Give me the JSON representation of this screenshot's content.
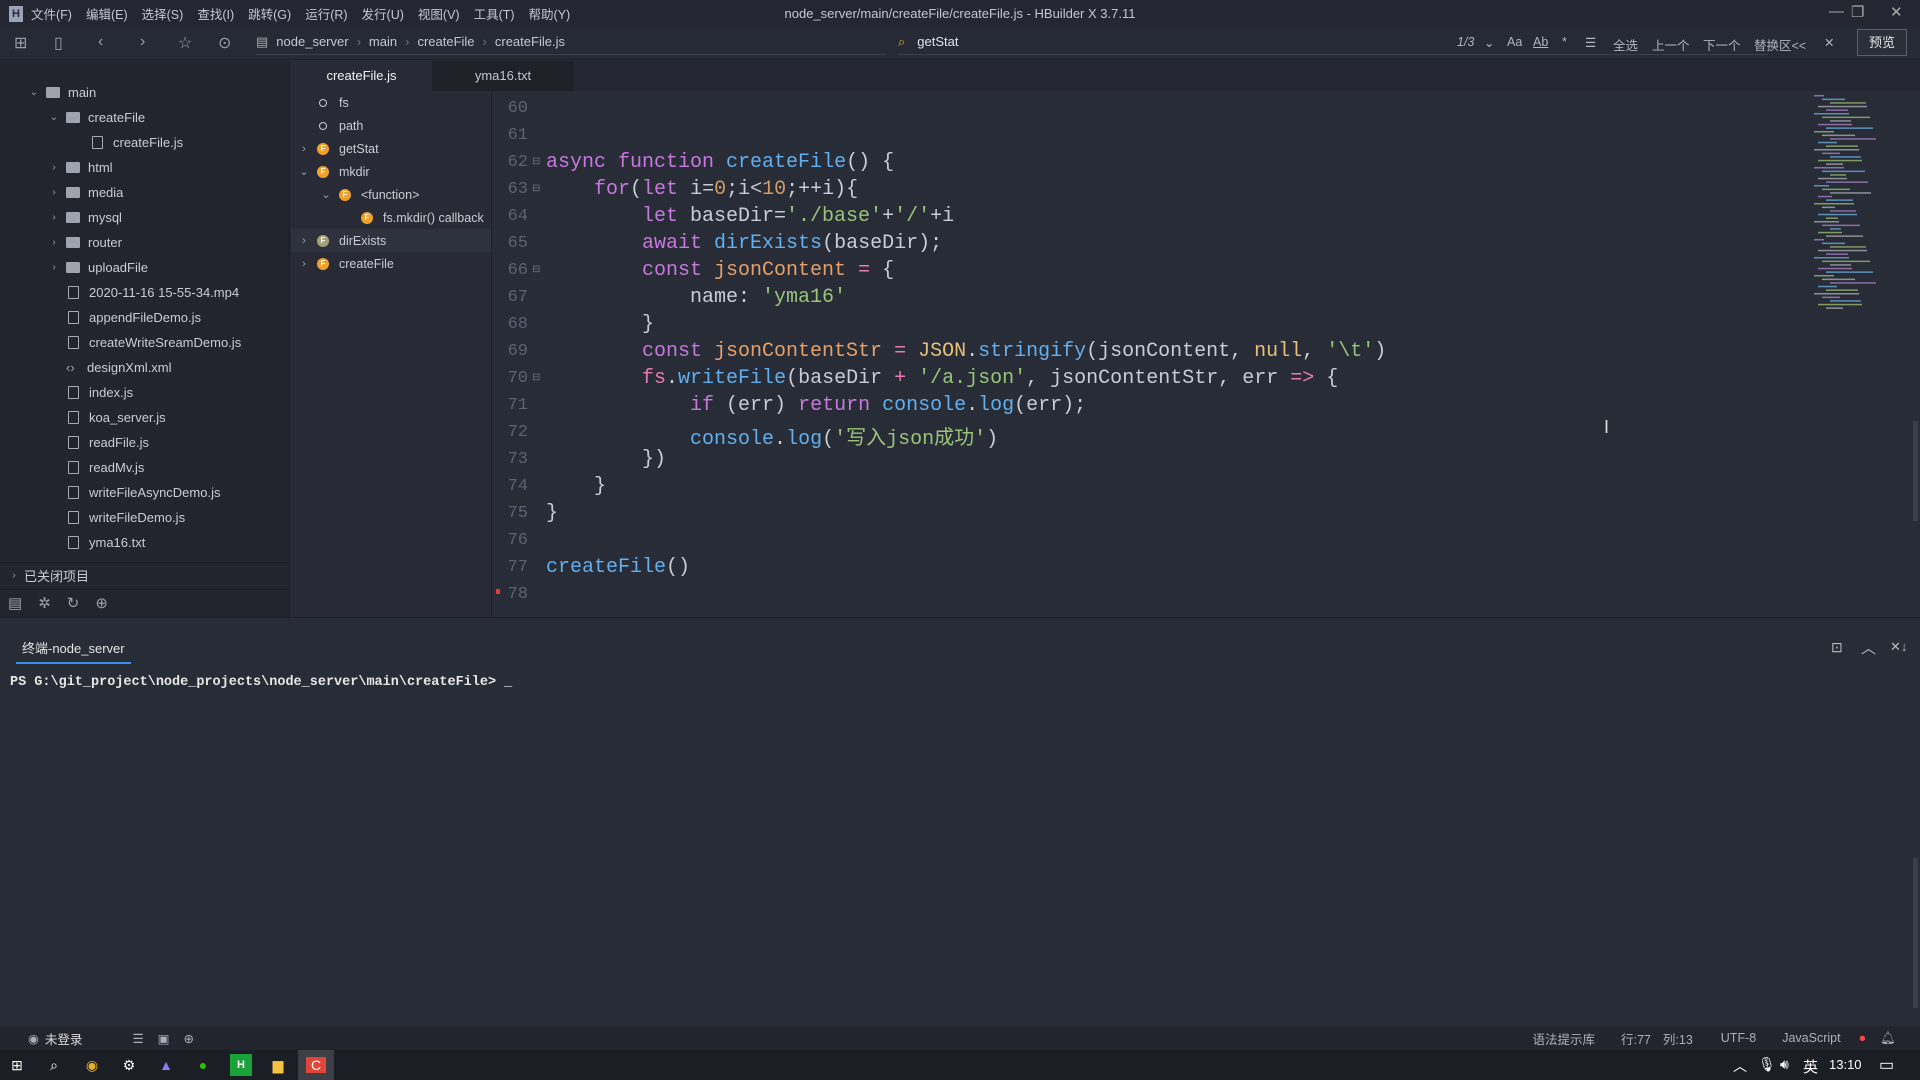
{
  "window": {
    "title": "node_server/main/createFile/createFile.js - HBuilder X 3.7.11",
    "logo": "H"
  },
  "menu": [
    "文件(F)",
    "编辑(E)",
    "选择(S)",
    "查找(I)",
    "跳转(G)",
    "运行(R)",
    "发行(U)",
    "视图(V)",
    "工具(T)",
    "帮助(Y)"
  ],
  "breadcrumb": [
    "node_server",
    "main",
    "createFile",
    "createFile.js"
  ],
  "search": {
    "value": "getStat",
    "count": "1/3",
    "options": [
      "Aa",
      "Ab",
      "*",
      "全选",
      "上一个",
      "下一个",
      "替换区<<"
    ],
    "preview": "预览"
  },
  "sidebar": {
    "tree": [
      {
        "label": "main",
        "type": "folder",
        "open": true,
        "depth": 0
      },
      {
        "label": "createFile",
        "type": "folder",
        "open": true,
        "depth": 1
      },
      {
        "label": "createFile.js",
        "type": "file",
        "depth": 2
      },
      {
        "label": "html",
        "type": "folder",
        "depth": 1
      },
      {
        "label": "media",
        "type": "folder",
        "depth": 1
      },
      {
        "label": "mysql",
        "type": "folder",
        "depth": 1
      },
      {
        "label": "router",
        "type": "folder",
        "depth": 1
      },
      {
        "label": "uploadFile",
        "type": "folder",
        "depth": 1
      },
      {
        "label": "2020-11-16 15-55-34.mp4",
        "type": "file",
        "depth": 1
      },
      {
        "label": "appendFileDemo.js",
        "type": "file",
        "depth": 1
      },
      {
        "label": "createWriteSreamDemo.js",
        "type": "file",
        "depth": 1
      },
      {
        "label": "designXml.xml",
        "type": "xml",
        "depth": 1
      },
      {
        "label": "index.js",
        "type": "file",
        "depth": 1
      },
      {
        "label": "koa_server.js",
        "type": "file",
        "depth": 1
      },
      {
        "label": "readFile.js",
        "type": "file",
        "depth": 1
      },
      {
        "label": "readMv.js",
        "type": "file",
        "depth": 1
      },
      {
        "label": "writeFileAsyncDemo.js",
        "type": "file",
        "depth": 1
      },
      {
        "label": "writeFileDemo.js",
        "type": "file",
        "depth": 1
      },
      {
        "label": "yma16.txt",
        "type": "file",
        "depth": 1
      }
    ],
    "closed_projects": "已关闭项目"
  },
  "tabs": [
    "createFile.js",
    "yma16.txt"
  ],
  "outline": [
    {
      "label": "fs",
      "kind": "var",
      "depth": 0
    },
    {
      "label": "path",
      "kind": "var",
      "depth": 0
    },
    {
      "label": "getStat",
      "kind": "fn",
      "depth": 0,
      "chev": "›"
    },
    {
      "label": "mkdir",
      "kind": "fn",
      "depth": 0,
      "chev": "⌄"
    },
    {
      "label": "<function>",
      "kind": "fn",
      "depth": 1,
      "chev": "⌄"
    },
    {
      "label": "fs.mkdir() callback",
      "kind": "fn",
      "depth": 2
    },
    {
      "label": "dirExists",
      "kind": "fn",
      "depth": 0,
      "chev": "›",
      "selected": true
    },
    {
      "label": "createFile",
      "kind": "fn",
      "depth": 0,
      "chev": "›"
    }
  ],
  "code": [
    {
      "n": "60",
      "t": []
    },
    {
      "n": "61",
      "t": []
    },
    {
      "n": "62",
      "fold": true,
      "t": [
        [
          "kw",
          "async "
        ],
        [
          "kw",
          "function "
        ],
        [
          "fn",
          "createFile"
        ],
        [
          "pl",
          "() {"
        ]
      ]
    },
    {
      "n": "63",
      "fold": true,
      "t": [
        [
          "pl",
          "    "
        ],
        [
          "kw",
          "for"
        ],
        [
          "pl",
          "("
        ],
        [
          "kw",
          "let "
        ],
        [
          "pl",
          "i="
        ],
        [
          "num",
          "0"
        ],
        [
          "pl",
          ";i<"
        ],
        [
          "num",
          "10"
        ],
        [
          "pl",
          ";++i){"
        ]
      ]
    },
    {
      "n": "64",
      "t": [
        [
          "pl",
          "        "
        ],
        [
          "kw",
          "let "
        ],
        [
          "pl",
          "baseDir="
        ],
        [
          "str",
          "'./base'"
        ],
        [
          "pl",
          "+"
        ],
        [
          "str",
          "'/'"
        ],
        [
          "pl",
          "+i"
        ]
      ]
    },
    {
      "n": "65",
      "t": [
        [
          "pl",
          "        "
        ],
        [
          "kw",
          "await "
        ],
        [
          "fn",
          "dirExists"
        ],
        [
          "pl",
          "(baseDir);"
        ]
      ]
    },
    {
      "n": "66",
      "fold": true,
      "t": [
        [
          "pl",
          "        "
        ],
        [
          "kw",
          "const "
        ],
        [
          "var",
          "jsonContent"
        ],
        [
          "op",
          " = "
        ],
        [
          "pl",
          "{"
        ]
      ]
    },
    {
      "n": "67",
      "t": [
        [
          "pl",
          "            name: "
        ],
        [
          "str",
          "'yma16'"
        ]
      ]
    },
    {
      "n": "68",
      "t": [
        [
          "pl",
          "        }"
        ]
      ]
    },
    {
      "n": "69",
      "t": [
        [
          "pl",
          "        "
        ],
        [
          "kw",
          "const "
        ],
        [
          "var",
          "jsonContentStr"
        ],
        [
          "op",
          " = "
        ],
        [
          "cls",
          "JSON"
        ],
        [
          "pl",
          "."
        ],
        [
          "fn",
          "stringify"
        ],
        [
          "pl",
          "(jsonContent, "
        ],
        [
          "cls",
          "null"
        ],
        [
          "pl",
          ", "
        ],
        [
          "str",
          "'\\t'"
        ],
        [
          "pl",
          ")"
        ]
      ]
    },
    {
      "n": "70",
      "fold": true,
      "t": [
        [
          "pl",
          "        "
        ],
        [
          "op",
          "fs"
        ],
        [
          "pl",
          "."
        ],
        [
          "fn",
          "writeFile"
        ],
        [
          "pl",
          "(baseDir "
        ],
        [
          "op",
          "+"
        ],
        [
          "pl",
          " "
        ],
        [
          "str",
          "'/a.json'"
        ],
        [
          "pl",
          ", jsonContentStr, err "
        ],
        [
          "op",
          "=>"
        ],
        [
          "pl",
          " {"
        ]
      ]
    },
    {
      "n": "71",
      "t": [
        [
          "pl",
          "            "
        ],
        [
          "kw",
          "if"
        ],
        [
          "pl",
          " (err) "
        ],
        [
          "kw",
          "return "
        ],
        [
          "fn",
          "console"
        ],
        [
          "pl",
          "."
        ],
        [
          "fn",
          "log"
        ],
        [
          "pl",
          "(err);"
        ]
      ]
    },
    {
      "n": "72",
      "t": [
        [
          "pl",
          "            "
        ],
        [
          "fn",
          "console"
        ],
        [
          "pl",
          "."
        ],
        [
          "fn",
          "log"
        ],
        [
          "pl",
          "("
        ],
        [
          "str",
          "'写入json成功'"
        ],
        [
          "pl",
          ")"
        ]
      ]
    },
    {
      "n": "73",
      "t": [
        [
          "pl",
          "        })"
        ]
      ]
    },
    {
      "n": "74",
      "t": [
        [
          "pl",
          "    }"
        ]
      ]
    },
    {
      "n": "75",
      "t": [
        [
          "pl",
          "}"
        ]
      ]
    },
    {
      "n": "76",
      "t": []
    },
    {
      "n": "77",
      "t": [
        [
          "fn",
          "createFile"
        ],
        [
          "pl",
          "()"
        ]
      ]
    },
    {
      "n": "78",
      "t": []
    }
  ],
  "terminal": {
    "tab": "终端-node_server",
    "prompt": "PS G:\\git_project\\node_projects\\node_server\\main\\createFile> _"
  },
  "status": {
    "login": "未登录",
    "hint_lib": "语法提示库",
    "row": "行:77",
    "col": "列:13",
    "encoding": "UTF-8",
    "language": "JavaScript"
  },
  "taskbar": {
    "ime": "英",
    "time": "13:10"
  },
  "colors": {
    "accent": "#3b8eea",
    "keyword": "#c678dd",
    "function": "#61afef",
    "string": "#98c379",
    "number": "#d19a66"
  }
}
